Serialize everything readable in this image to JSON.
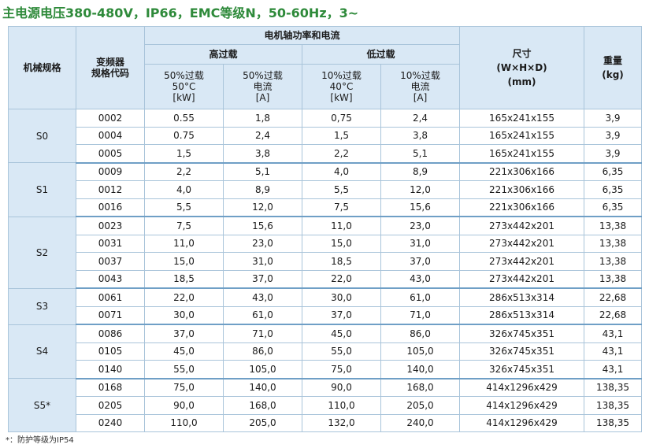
{
  "title": "主电源电压380-480V，IP66，EMC等级N，50-60Hz，3~",
  "table": {
    "col_model": "机械规格",
    "col_code": "变频器\n规格代码",
    "col_power_group": "电机轴功率和电流",
    "col_high": "高过载",
    "col_low": "低过载",
    "col_size": "尺寸\n(W×H×D)\n(mm)",
    "col_weight": "重量\n(kg)",
    "sub_high_power": "50%过载\n50°C\n[kW]",
    "sub_high_current": "50%过载\n电流\n[A]",
    "sub_low_power": "10%过载\n40°C\n[kW]",
    "sub_low_current": "10%过载\n电流\n[A]",
    "groups": [
      {
        "model": "S0",
        "rows": [
          [
            "0002",
            "0.55",
            "1,8",
            "0,75",
            "2,4",
            "165x241x155",
            "3,9"
          ],
          [
            "0004",
            "0.75",
            "2,4",
            "1,5",
            "3,8",
            "165x241x155",
            "3,9"
          ],
          [
            "0005",
            "1,5",
            "3,8",
            "2,2",
            "5,1",
            "165x241x155",
            "3,9"
          ]
        ]
      },
      {
        "model": "S1",
        "rows": [
          [
            "0009",
            "2,2",
            "5,1",
            "4,0",
            "8,9",
            "221x306x166",
            "6,35"
          ],
          [
            "0012",
            "4,0",
            "8,9",
            "5,5",
            "12,0",
            "221x306x166",
            "6,35"
          ],
          [
            "0016",
            "5,5",
            "12,0",
            "7,5",
            "15,6",
            "221x306x166",
            "6,35"
          ]
        ]
      },
      {
        "model": "S2",
        "rows": [
          [
            "0023",
            "7,5",
            "15,6",
            "11,0",
            "23,0",
            "273x442x201",
            "13,38"
          ],
          [
            "0031",
            "11,0",
            "23,0",
            "15,0",
            "31,0",
            "273x442x201",
            "13,38"
          ],
          [
            "0037",
            "15,0",
            "31,0",
            "18,5",
            "37,0",
            "273x442x201",
            "13,38"
          ],
          [
            "0043",
            "18,5",
            "37,0",
            "22,0",
            "43,0",
            "273x442x201",
            "13,38"
          ]
        ]
      },
      {
        "model": "S3",
        "rows": [
          [
            "0061",
            "22,0",
            "43,0",
            "30,0",
            "61,0",
            "286x513x314",
            "22,68"
          ],
          [
            "0071",
            "30,0",
            "61,0",
            "37,0",
            "71,0",
            "286x513x314",
            "22,68"
          ]
        ]
      },
      {
        "model": "S4",
        "rows": [
          [
            "0086",
            "37,0",
            "71,0",
            "45,0",
            "86,0",
            "326x745x351",
            "43,1"
          ],
          [
            "0105",
            "45,0",
            "86,0",
            "55,0",
            "105,0",
            "326x745x351",
            "43,1"
          ],
          [
            "0140",
            "55,0",
            "105,0",
            "75,0",
            "140,0",
            "326x745x351",
            "43,1"
          ]
        ]
      },
      {
        "model": "S5*",
        "rows": [
          [
            "0168",
            "75,0",
            "140,0",
            "90,0",
            "168,0",
            "414x1296x429",
            "138,35"
          ],
          [
            "0205",
            "90,0",
            "168,0",
            "110,0",
            "205,0",
            "414x1296x429",
            "138,35"
          ],
          [
            "0240",
            "110,0",
            "205,0",
            "132,0",
            "240,0",
            "414x1296x429",
            "138,35"
          ]
        ]
      }
    ]
  },
  "footnote": "*：防护等级为IP54"
}
